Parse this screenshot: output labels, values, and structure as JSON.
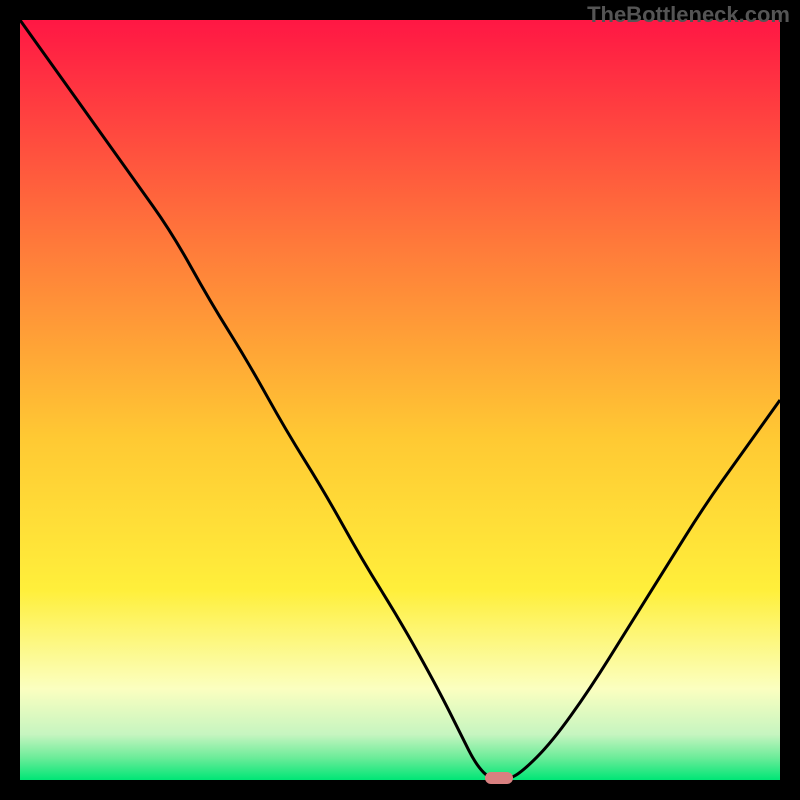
{
  "watermark": "TheBottleneck.com",
  "colors": {
    "black": "#000000",
    "gradient_top": "#ff1744",
    "gradient_mid_upper": "#ff5c3a",
    "gradient_mid": "#ffb300",
    "gradient_mid_lower": "#ffe63b",
    "gradient_lower": "#faffb3",
    "gradient_green_light": "#b2f5c0",
    "gradient_green": "#00e676",
    "curve": "#000000",
    "marker": "#d98080"
  },
  "chart_data": {
    "type": "line",
    "title": "",
    "xlabel": "",
    "ylabel": "",
    "xlim": [
      0,
      100
    ],
    "ylim": [
      0,
      100
    ],
    "x": [
      0,
      5,
      10,
      15,
      20,
      25,
      30,
      35,
      40,
      45,
      50,
      55,
      58,
      60,
      62,
      64,
      66,
      70,
      75,
      80,
      85,
      90,
      95,
      100
    ],
    "values": [
      100,
      93,
      86,
      79,
      72,
      63,
      55,
      46,
      38,
      29,
      21,
      12,
      6,
      2,
      0,
      0,
      1,
      5,
      12,
      20,
      28,
      36,
      43,
      50
    ],
    "marker_x": 63,
    "marker_y": 0,
    "gradient_stops": [
      {
        "pos": 0,
        "color": "#ff1744"
      },
      {
        "pos": 30,
        "color": "#ff7b3a"
      },
      {
        "pos": 55,
        "color": "#ffc933"
      },
      {
        "pos": 75,
        "color": "#ffef3b"
      },
      {
        "pos": 88,
        "color": "#fbffc0"
      },
      {
        "pos": 94,
        "color": "#c6f5c0"
      },
      {
        "pos": 97,
        "color": "#6eec9a"
      },
      {
        "pos": 100,
        "color": "#00e676"
      }
    ]
  }
}
